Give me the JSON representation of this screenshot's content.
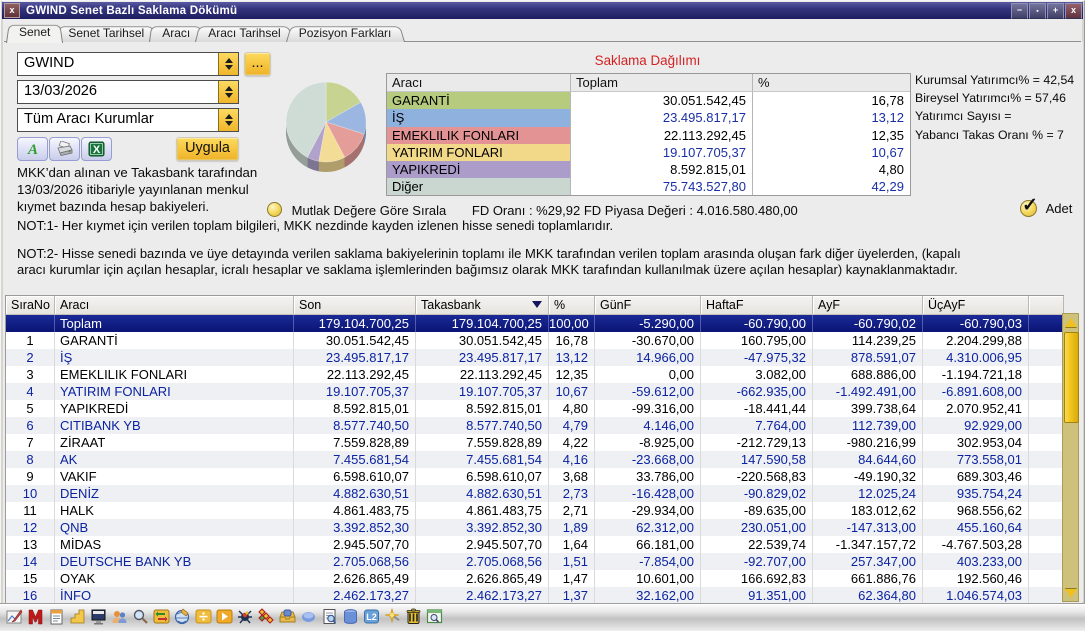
{
  "window": {
    "title": "GWIND Senet Bazlı Saklama Dökümü",
    "controls": {
      "minimize": "−",
      "restore": "▪",
      "maximize": "+",
      "close": "x"
    }
  },
  "tabs": [
    {
      "key": "senet",
      "label": "Senet",
      "active": true
    },
    {
      "key": "senet-tarihsel",
      "label": "Senet Tarihsel",
      "active": false
    },
    {
      "key": "araci",
      "label": "Aracı",
      "active": false
    },
    {
      "key": "araci-tarihsel",
      "label": "Aracı Tarihsel",
      "active": false
    },
    {
      "key": "pozisyon-farklari",
      "label": "Pozisyon Farkları",
      "active": false
    }
  ],
  "filters": {
    "symbol": "GWIND",
    "date": "13/03/2026",
    "broker": "Tüm Aracı Kurumlar",
    "more_button": "...",
    "apply_button": "Uygula",
    "tool_buttons": [
      "font-button",
      "print-button",
      "excel-button"
    ]
  },
  "info_text": "MKK’dan alınan ve Takasbank tarafından 13/03/2026 itibariyle yayınlanan menkul kıymet bazında hesap bakiyeleri.",
  "distribution": {
    "title": "Saklama Dağılımı",
    "headers": [
      "Aracı",
      "Toplam",
      "%"
    ],
    "rows": [
      {
        "label": "GARANTİ",
        "total": "30.051.542,45",
        "pct": "16,78",
        "color": "#b6cb7e"
      },
      {
        "label": "İŞ",
        "total": "23.495.817,17",
        "pct": "13,12",
        "color": "#8fb1dd"
      },
      {
        "label": "EMEKLILIK FONLARI",
        "total": "22.113.292,45",
        "pct": "12,35",
        "color": "#e49394"
      },
      {
        "label": "YATIRIM FONLARI",
        "total": "19.107.705,37",
        "pct": "10,67",
        "color": "#f2d989"
      },
      {
        "label": "YAPIKREDİ",
        "total": "8.592.815,01",
        "pct": "4,80",
        "color": "#ab9cc9"
      },
      {
        "label": "Diğer",
        "total": "75.743.527,80",
        "pct": "42,29",
        "color": "#c9d7d0"
      }
    ]
  },
  "stats": [
    "Kurumsal Yatırımcı% = 42,54",
    "Bireysel Yatırımcı% = 57,46",
    "Yatırımcı Sayısı =",
    "Yabancı Takas Oranı % = 7"
  ],
  "sort_row": {
    "radio_label": "Mutlak Değere Göre Sırala",
    "fd_text": "FD Oranı : %29,92 FD Piyasa Değeri : 4.016.580.480,00",
    "checkbox_label": "Adet",
    "checkbox_checked": true
  },
  "notes": [
    "NOT:1- Her kıymet için verilen toplam bilgileri, MKK nezdinde kayden izlenen hisse senedi toplamlarıdır.",
    "NOT:2- Hisse senedi bazında ve üye detayında verilen saklama bakiyelerinin toplamı ile MKK tarafından verilen toplam arasında oluşan fark diğer üyelerden, (kapalı aracı kurumlar için açılan hesaplar, icralı hesaplar ve saklama işlemlerinden bağımsız olarak MKK tarafından kullanılmak üzere açılan hesaplar) kaynaklanmaktadır."
  ],
  "main_table": {
    "headers": [
      "SıraNo",
      "Aracı",
      "Son",
      "Takasbank",
      "%",
      "GünF",
      "HaftaF",
      "AyF",
      "ÜçAyF"
    ],
    "sort_column": "Takasbank",
    "selected_row": "Toplam",
    "rows": [
      [
        "",
        "Toplam",
        "179.104.700,25",
        "179.104.700,25",
        "100,00",
        "-5.290,00",
        "-60.790,00",
        "-60.790,02",
        "-60.790,03"
      ],
      [
        "1",
        "GARANTİ",
        "30.051.542,45",
        "30.051.542,45",
        "16,78",
        "-30.670,00",
        "160.795,00",
        "114.239,25",
        "2.204.299,88"
      ],
      [
        "2",
        "İŞ",
        "23.495.817,17",
        "23.495.817,17",
        "13,12",
        "14.966,00",
        "-47.975,32",
        "878.591,07",
        "4.310.006,95"
      ],
      [
        "3",
        "EMEKLILIK FONLARI",
        "22.113.292,45",
        "22.113.292,45",
        "12,35",
        "0,00",
        "3.082,00",
        "688.886,00",
        "-1.194.721,18"
      ],
      [
        "4",
        "YATIRIM FONLARI",
        "19.107.705,37",
        "19.107.705,37",
        "10,67",
        "-59.612,00",
        "-662.935,00",
        "-1.492.491,00",
        "-6.891.608,00"
      ],
      [
        "5",
        "YAPIKREDİ",
        "8.592.815,01",
        "8.592.815,01",
        "4,80",
        "-99.316,00",
        "-18.441,44",
        "399.738,64",
        "2.070.952,41"
      ],
      [
        "6",
        "CITIBANK YB",
        "8.577.740,50",
        "8.577.740,50",
        "4,79",
        "4.146,00",
        "7.764,00",
        "112.739,00",
        "92.929,00"
      ],
      [
        "7",
        "ZİRAAT",
        "7.559.828,89",
        "7.559.828,89",
        "4,22",
        "-8.925,00",
        "-212.729,13",
        "-980.216,99",
        "302.953,04"
      ],
      [
        "8",
        "AK",
        "7.455.681,54",
        "7.455.681,54",
        "4,16",
        "-23.668,00",
        "147.590,58",
        "84.644,60",
        "773.558,01"
      ],
      [
        "9",
        "VAKIF",
        "6.598.610,07",
        "6.598.610,07",
        "3,68",
        "33.786,00",
        "-220.568,83",
        "-49.190,32",
        "689.303,46"
      ],
      [
        "10",
        "DENİZ",
        "4.882.630,51",
        "4.882.630,51",
        "2,73",
        "-16.428,00",
        "-90.829,02",
        "12.025,24",
        "935.754,24"
      ],
      [
        "11",
        "HALK",
        "4.861.483,75",
        "4.861.483,75",
        "2,71",
        "-29.934,00",
        "-89.635,00",
        "183.012,62",
        "968.556,62"
      ],
      [
        "12",
        "QNB",
        "3.392.852,30",
        "3.392.852,30",
        "1,89",
        "62.312,00",
        "230.051,00",
        "-147.313,00",
        "455.160,64"
      ],
      [
        "13",
        "MİDAS",
        "2.945.507,70",
        "2.945.507,70",
        "1,64",
        "66.181,00",
        "22.539,74",
        "-1.347.157,72",
        "-4.767.503,28"
      ],
      [
        "14",
        "DEUTSCHE BANK YB",
        "2.705.068,56",
        "2.705.068,56",
        "1,51",
        "-7.854,00",
        "-92.707,00",
        "257.347,00",
        "403.233,00"
      ],
      [
        "15",
        "OYAK",
        "2.626.865,49",
        "2.626.865,49",
        "1,47",
        "10.601,00",
        "166.692,83",
        "661.886,76",
        "192.560,46"
      ],
      [
        "16",
        "İNFO",
        "2.462.173,27",
        "2.462.173,27",
        "1,37",
        "32.162,00",
        "91.351,00",
        "62.364,80",
        "1.046.574,03"
      ]
    ]
  },
  "chart_data": {
    "type": "pie",
    "title": "Saklama Dağılımı",
    "labels": [
      "GARANTİ",
      "İŞ",
      "EMEKLILIK FONLARI",
      "YATIRIM FONLARI",
      "YAPIKREDİ",
      "Diğer"
    ],
    "values": [
      16.78,
      13.12,
      12.35,
      10.67,
      4.8,
      42.29
    ],
    "colors": [
      "#c7d391",
      "#9bb7e1",
      "#e59d99",
      "#f3dc95",
      "#b1a2cb",
      "#cfdbd5"
    ],
    "start_angle_deg": -90,
    "direction": "clockwise",
    "style": "3d",
    "legend_position": "none"
  },
  "bottom_toolbar_icons": [
    "chart-edit",
    "matriks-m",
    "notepad",
    "steps",
    "monitor",
    "users",
    "magnifier",
    "transfer",
    "globe-brush",
    "divide-box",
    "play-box",
    "spider",
    "chevrons",
    "inbox",
    "blue-button",
    "doc-zoom",
    "database",
    "level2",
    "sparkle-tools",
    "trash",
    "window-zoom"
  ],
  "colors": {
    "titlebar": "#34347e",
    "gold": "#f3bc33",
    "client_bg": "#ececec",
    "selected_row": "#0d1880",
    "alt_row_bg": "#eef0f4",
    "alt_row_text": "#0b23a0",
    "dist_title": "#d42222",
    "scroll_track": "#cdc17b",
    "scroll_thumb": "#f2c71d"
  }
}
